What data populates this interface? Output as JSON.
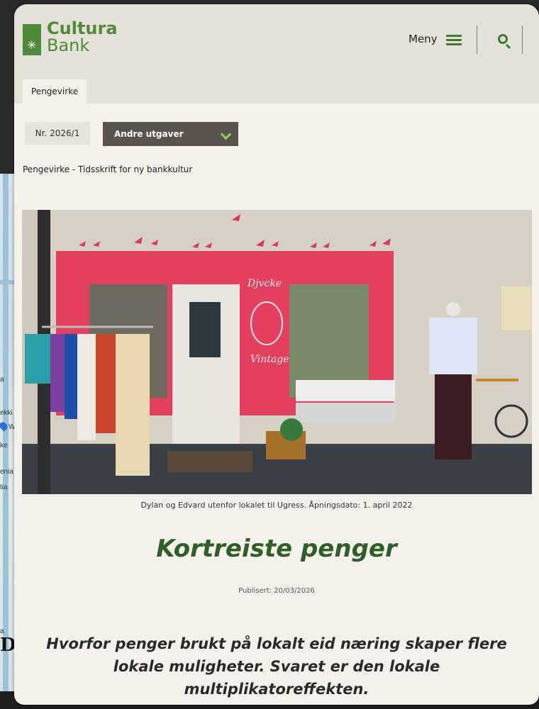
{
  "background": {
    "map_labels": [
      "a",
      "ekki",
      "W",
      "ke",
      "enia",
      "tia",
      "a"
    ],
    "logo_fragment": "Dr"
  },
  "header": {
    "brand_line1": "Cultura",
    "brand_line2": "Bank",
    "menu_label": "Meny"
  },
  "section_tab": "Pengevirke",
  "issue": {
    "number": "Nr. 2026/1",
    "other_issues_label": "Andre utgaver"
  },
  "breadcrumb": "Pengevirke - Tidsskrift for ny bankkultur",
  "hero": {
    "shop_sign_top": "Djvcke",
    "shop_sign_bottom": "Vintage"
  },
  "article": {
    "caption": "Dylan og Edvard utenfor lokalet til Ugress. Åpningsdato: 1. april 2022",
    "title": "Kortreiste penger",
    "published": "Publisert: 20/03/2026",
    "lead": "Hvorfor penger brukt på lokalt eid næring skaper flere lokale muligheter. Svaret er den lokale multiplikatoreffekten."
  },
  "colors": {
    "brand_green": "#4f8a3a",
    "title_green": "#2f5e2a",
    "dropdown_bg": "#5a534e",
    "chevron_green": "#9ccd55"
  }
}
